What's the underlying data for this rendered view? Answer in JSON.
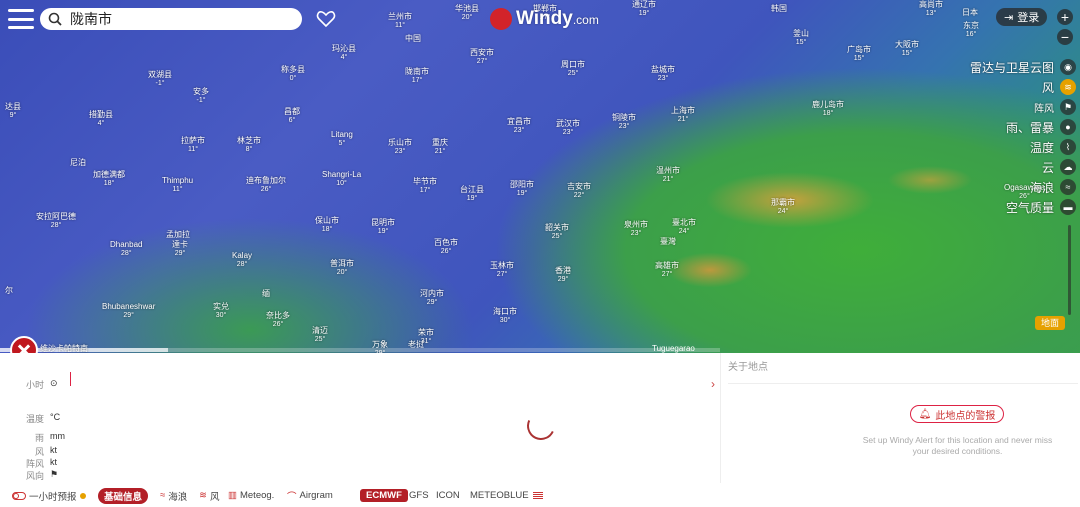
{
  "search": {
    "value": "陇南市"
  },
  "logo": {
    "word": "Windy",
    "suffix": ".com"
  },
  "login": {
    "label": "登录"
  },
  "zoom": {
    "plus": "+",
    "minus": "−"
  },
  "layers": [
    {
      "label": "雷达与卫星云图",
      "icon": "globe-icon",
      "glyph": "◉",
      "active": false,
      "small": false
    },
    {
      "label": "风",
      "icon": "wind-icon",
      "glyph": "≋",
      "active": true,
      "small": false
    },
    {
      "label": "阵风",
      "icon": "flag-icon",
      "glyph": "⚑",
      "active": false,
      "small": true
    },
    {
      "label": "雨、雷暴",
      "icon": "drop-icon",
      "glyph": "●",
      "active": false,
      "small": false
    },
    {
      "label": "温度",
      "icon": "thermometer-icon",
      "glyph": "⌇",
      "active": false,
      "small": false
    },
    {
      "label": "云",
      "icon": "cloud-icon",
      "glyph": "☁",
      "active": false,
      "small": false
    },
    {
      "label": "海浪",
      "icon": "waves-icon",
      "glyph": "≈",
      "active": false,
      "small": false
    },
    {
      "label": "空气质量",
      "icon": "car-icon",
      "glyph": "▬",
      "active": false,
      "small": false
    }
  ],
  "map_button": {
    "label": "地面"
  },
  "credit": "维沙卡帕特南",
  "credit_right": "Tuguegarao",
  "cities": [
    {
      "name": "兰州市",
      "temp": "11°"
    },
    {
      "name": "华池县",
      "temp": "20°"
    },
    {
      "name": "邯郸市",
      "temp": "27°"
    },
    {
      "name": "通辽市",
      "temp": "19°"
    },
    {
      "name": "韩国",
      "temp": ""
    },
    {
      "name": "高尚市",
      "temp": "13°"
    },
    {
      "name": "日本",
      "temp": ""
    },
    {
      "name": "东京",
      "temp": "16°"
    },
    {
      "name": "中国",
      "temp": ""
    },
    {
      "name": "玛沁县",
      "temp": "4°"
    },
    {
      "name": "西安市",
      "temp": "27°"
    },
    {
      "name": "周口市",
      "temp": "25°"
    },
    {
      "name": "盐城市",
      "temp": "23°"
    },
    {
      "name": "釜山",
      "temp": "15°"
    },
    {
      "name": "广岛市",
      "temp": "15°"
    },
    {
      "name": "大阪市",
      "temp": "15°"
    },
    {
      "name": "双湖县",
      "temp": "-1°"
    },
    {
      "name": "称多县",
      "temp": "0°"
    },
    {
      "name": "陇南市",
      "temp": "17°"
    },
    {
      "name": "安多",
      "temp": "-1°"
    },
    {
      "name": "达县",
      "temp": "9°"
    },
    {
      "name": "措勤县",
      "temp": "4°"
    },
    {
      "name": "昌都",
      "temp": "6°"
    },
    {
      "name": "宜昌市",
      "temp": "23°"
    },
    {
      "name": "武汉市",
      "temp": "23°"
    },
    {
      "name": "铜陵市",
      "temp": "23°"
    },
    {
      "name": "上海市",
      "temp": "21°"
    },
    {
      "name": "鹿儿岛市",
      "temp": "18°"
    },
    {
      "name": "拉萨市",
      "temp": "11°"
    },
    {
      "name": "林芝市",
      "temp": "8°"
    },
    {
      "name": "Litang",
      "temp": "5°"
    },
    {
      "name": "乐山市",
      "temp": "23°"
    },
    {
      "name": "重庆",
      "temp": "21°"
    },
    {
      "name": "尼泊",
      "temp": ""
    },
    {
      "name": "加德满都",
      "temp": "18°"
    },
    {
      "name": "Thimphu",
      "temp": "11°"
    },
    {
      "name": "迪布鲁加尔",
      "temp": "26°"
    },
    {
      "name": "Shangri-La",
      "temp": "10°"
    },
    {
      "name": "毕节市",
      "temp": "17°"
    },
    {
      "name": "台江县",
      "temp": "19°"
    },
    {
      "name": "邵阳市",
      "temp": "19°"
    },
    {
      "name": "吉安市",
      "temp": "22°"
    },
    {
      "name": "温州市",
      "temp": "21°"
    },
    {
      "name": "那霸市",
      "temp": "24°"
    },
    {
      "name": "Ogasawara",
      "temp": "26°"
    },
    {
      "name": "安拉阿巴德",
      "temp": "28°"
    },
    {
      "name": "Dhanbad",
      "temp": "28°"
    },
    {
      "name": "孟加拉",
      "temp": ""
    },
    {
      "name": "達卡",
      "temp": "29°"
    },
    {
      "name": "Kalay",
      "temp": "28°"
    },
    {
      "name": "保山市",
      "temp": "18°"
    },
    {
      "name": "昆明市",
      "temp": "19°"
    },
    {
      "name": "韶关市",
      "temp": "25°"
    },
    {
      "name": "泉州市",
      "temp": "23°"
    },
    {
      "name": "臺北市",
      "temp": "24°"
    },
    {
      "name": "臺灣",
      "temp": ""
    },
    {
      "name": "普洱市",
      "temp": "20°"
    },
    {
      "name": "百色市",
      "temp": "26°"
    },
    {
      "name": "玉林市",
      "temp": "27°"
    },
    {
      "name": "香港",
      "temp": "29°"
    },
    {
      "name": "高雄市",
      "temp": "27°"
    },
    {
      "name": "缅",
      "temp": ""
    },
    {
      "name": "Bhubaneshwar",
      "temp": "29°"
    },
    {
      "name": "实兑",
      "temp": "30°"
    },
    {
      "name": "奈比多",
      "temp": "26°"
    },
    {
      "name": "河内市",
      "temp": "29°"
    },
    {
      "name": "海口市",
      "temp": "30°"
    },
    {
      "name": "清迈",
      "temp": "25°"
    },
    {
      "name": "荣市",
      "temp": "31°"
    },
    {
      "name": "万象",
      "temp": "29°"
    },
    {
      "name": "老挝",
      "temp": ""
    },
    {
      "name": "尔",
      "temp": ""
    }
  ],
  "rows": {
    "hour": {
      "label": "小时",
      "unit": "⊙"
    },
    "temp": {
      "label": "温度",
      "unit": "°C"
    },
    "rain": {
      "label": "雨",
      "unit": "mm"
    },
    "wind": {
      "label": "风",
      "unit": "kt"
    },
    "gust": {
      "label": "阵风",
      "unit": "kt"
    },
    "dir": {
      "label": "风向",
      "unit": "⚑"
    }
  },
  "about": {
    "title": "关于地点",
    "chevron": "›",
    "alert_button": "此地点的警报",
    "alert_text": "Set up Windy Alert for this location and never miss your desired conditions."
  },
  "bottom": {
    "hourly": "一小时预报",
    "tabs": [
      "基础信息",
      "海浪",
      "风",
      "Meteog.",
      "Airgram"
    ],
    "models": [
      "ECMWF",
      "GFS",
      "ICON",
      "METEOBLUE"
    ]
  },
  "colors": {
    "accent": "#b31f27",
    "active_layer": "#e6a100"
  }
}
